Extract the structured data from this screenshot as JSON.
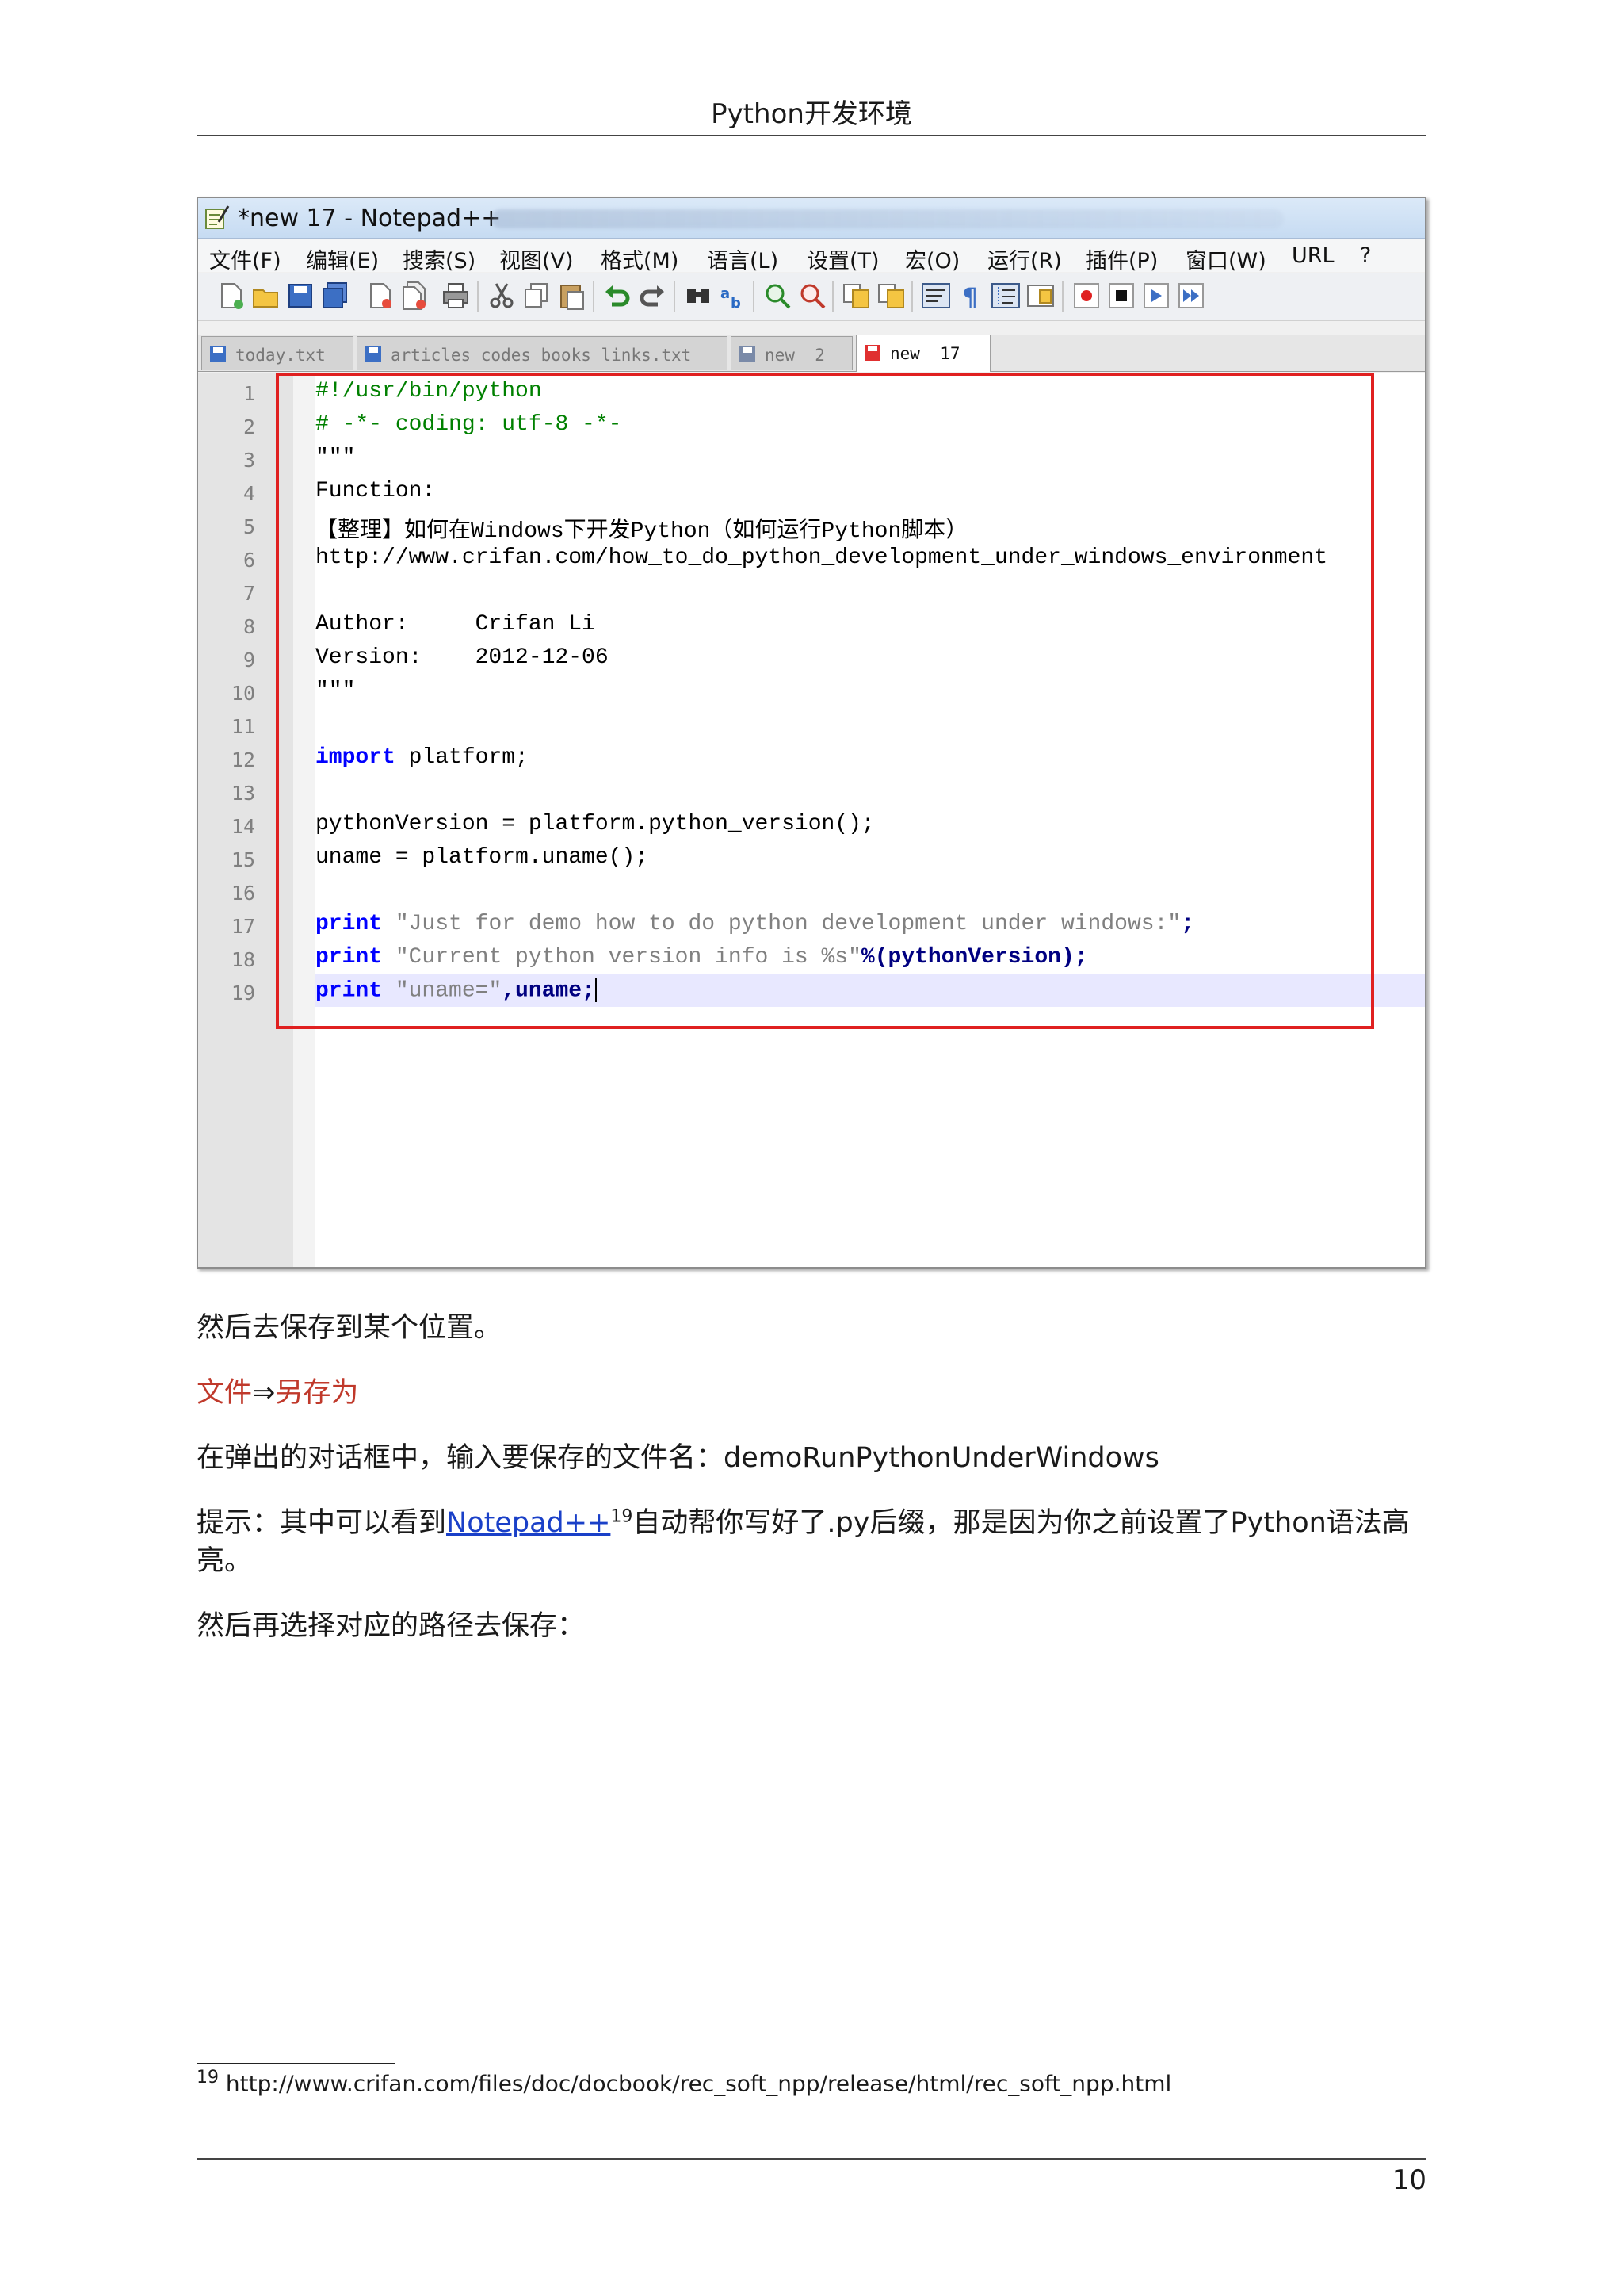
{
  "header": {
    "title": "Python开发环境"
  },
  "window": {
    "title": "*new  17 - Notepad++"
  },
  "menu": [
    {
      "label": "文件(F)"
    },
    {
      "label": "编辑(E)"
    },
    {
      "label": "搜索(S)"
    },
    {
      "label": "视图(V)"
    },
    {
      "label": "格式(M)"
    },
    {
      "label": "语言(L)"
    },
    {
      "label": "设置(T)"
    },
    {
      "label": "宏(O)"
    },
    {
      "label": "运行(R)"
    },
    {
      "label": "插件(P)"
    },
    {
      "label": "窗口(W)"
    },
    {
      "label": "URL"
    },
    {
      "label": "?"
    }
  ],
  "toolbar_icons": [
    "new-file",
    "open-file",
    "save",
    "save-all",
    "close",
    "close-all",
    "print",
    "cut",
    "copy",
    "paste",
    "undo",
    "redo",
    "find",
    "replace",
    "zoom-in",
    "zoom-out",
    "sync-v",
    "sync-h",
    "word-wrap",
    "show-all-chars",
    "indent-guide",
    "doc-map",
    "record-macro",
    "stop-macro",
    "play-macro",
    "run-macro-multiple"
  ],
  "tabs": [
    {
      "label": "today.txt",
      "active": false
    },
    {
      "label": "articles codes books links.txt",
      "active": false
    },
    {
      "label": "new  2",
      "active": false
    },
    {
      "label": "new  17",
      "active": true
    }
  ],
  "code": {
    "line_numbers": [
      "1",
      "2",
      "3",
      "4",
      "5",
      "6",
      "7",
      "8",
      "9",
      "10",
      "11",
      "12",
      "13",
      "14",
      "15",
      "16",
      "17",
      "18",
      "19"
    ],
    "lines": [
      {
        "kind": "comment",
        "text": "#!/usr/bin/python"
      },
      {
        "kind": "comment",
        "text": "# -*- coding: utf-8 -*-"
      },
      {
        "kind": "plain",
        "text": "\"\"\""
      },
      {
        "kind": "plain",
        "text": "Function:"
      },
      {
        "kind": "plain",
        "text": "【整理】如何在Windows下开发Python（如何运行Python脚本）"
      },
      {
        "kind": "plain",
        "text": "http://www.crifan.com/how_to_do_python_development_under_windows_environment"
      },
      {
        "kind": "plain",
        "text": ""
      },
      {
        "kind": "plain",
        "text": "Author:     Crifan Li"
      },
      {
        "kind": "plain",
        "text": "Version:    2012-12-06"
      },
      {
        "kind": "plain",
        "text": "\"\"\""
      },
      {
        "kind": "plain",
        "text": ""
      },
      {
        "kind": "import",
        "kw": "import",
        "text": " platform;"
      },
      {
        "kind": "plain",
        "text": ""
      },
      {
        "kind": "plain",
        "text": "pythonVersion = platform.python_version();"
      },
      {
        "kind": "plain",
        "text": "uname = platform.uname();"
      },
      {
        "kind": "plain",
        "text": ""
      },
      {
        "kind": "print",
        "kw": "print",
        "str": " \"Just for demo how to do python development under windows:\"",
        "rest": ";"
      },
      {
        "kind": "print",
        "kw": "print",
        "str": " \"Current python version info is %s\"",
        "rest": "%(pythonVersion);"
      },
      {
        "kind": "print",
        "kw": "print",
        "str": " \"uname=\"",
        "rest": ",uname;"
      }
    ]
  },
  "body": {
    "p1": "然后去保存到某个位置。",
    "p2_a": "文件",
    "p2_arrow": "⇒",
    "p2_b": "另存为",
    "p3": "在弹出的对话框中，输入要保存的文件名：demoRunPythonUnderWindows",
    "p4_pre": "提示：其中可以看到",
    "p4_link": "Notepad++",
    "p4_sup": "19",
    "p4_post": "自动帮你写好了.py后缀，那是因为你之前设置了Python语法高",
    "p4_line2": "亮。",
    "p5": "然后再选择对应的路径去保存："
  },
  "footnote": {
    "num": "19",
    "url": "http://www.crifan.com/files/doc/docbook/rec_soft_npp/release/html/rec_soft_npp.html"
  },
  "page_number": "10",
  "colors": {
    "highlight_box": "#e02020",
    "link": "#1a40c8",
    "menu_path": "#c0392b",
    "comment": "#008000",
    "keyword": "#0000ff"
  }
}
